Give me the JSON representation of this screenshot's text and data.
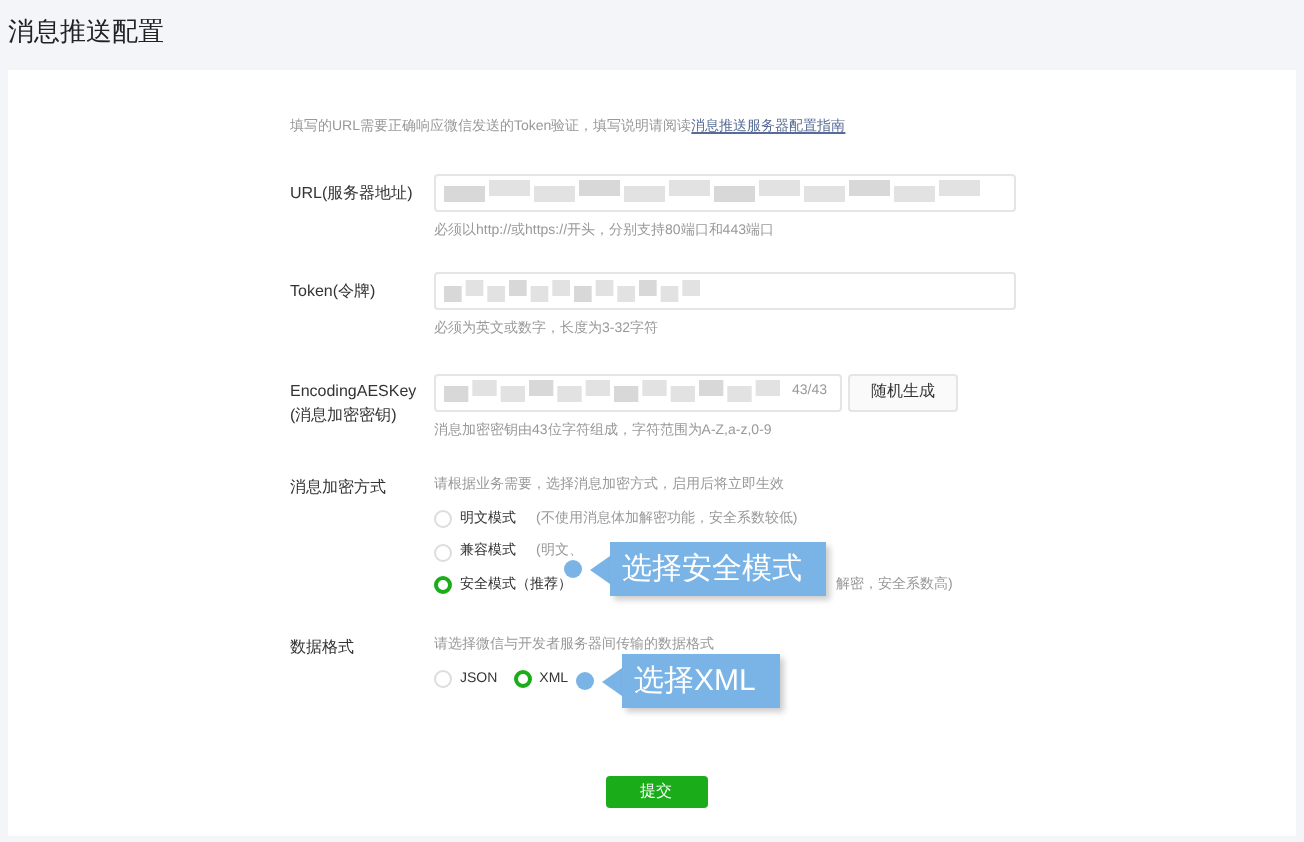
{
  "page_title": "消息推送配置",
  "intro": {
    "text": "填写的URL需要正确响应微信发送的Token验证，填写说明请阅读",
    "link": "消息推送服务器配置指南"
  },
  "fields": [
    {
      "label": "URL(服务器地址)",
      "hint": "必须以http://或https://开头，分别支持80端口和443端口"
    },
    {
      "label": "Token(令牌)",
      "hint": "必须为英文或数字，长度为3-32字符"
    },
    {
      "label": "EncodingAESKey",
      "label_2": "(消息加密密钥)",
      "counter": "43/43",
      "button": "随机生成",
      "hint": "消息加密密钥由43位字符组成，字符范围为A-Z,a-z,0-9"
    }
  ],
  "encryption": {
    "label": "消息加密方式",
    "hint": "请根据业务需要，选择消息加密方式，启用后将立即生效",
    "options": [
      {
        "label": "明文模式",
        "note": "(不使用消息体加解密功能，安全系数较低)",
        "selected": false
      },
      {
        "label": "兼容模式",
        "note": "(明文、",
        "selected": false
      },
      {
        "label": "安全模式（推荐）",
        "note": "解密，安全系数高)",
        "selected": true
      }
    ]
  },
  "data_format": {
    "label": "数据格式",
    "hint": "请选择微信与开发者服务器间传输的数据格式",
    "options": [
      {
        "label": "JSON",
        "selected": false
      },
      {
        "label": "XML",
        "selected": true
      }
    ]
  },
  "submit": "提交",
  "callouts": [
    "选择安全模式",
    "选择XML"
  ]
}
